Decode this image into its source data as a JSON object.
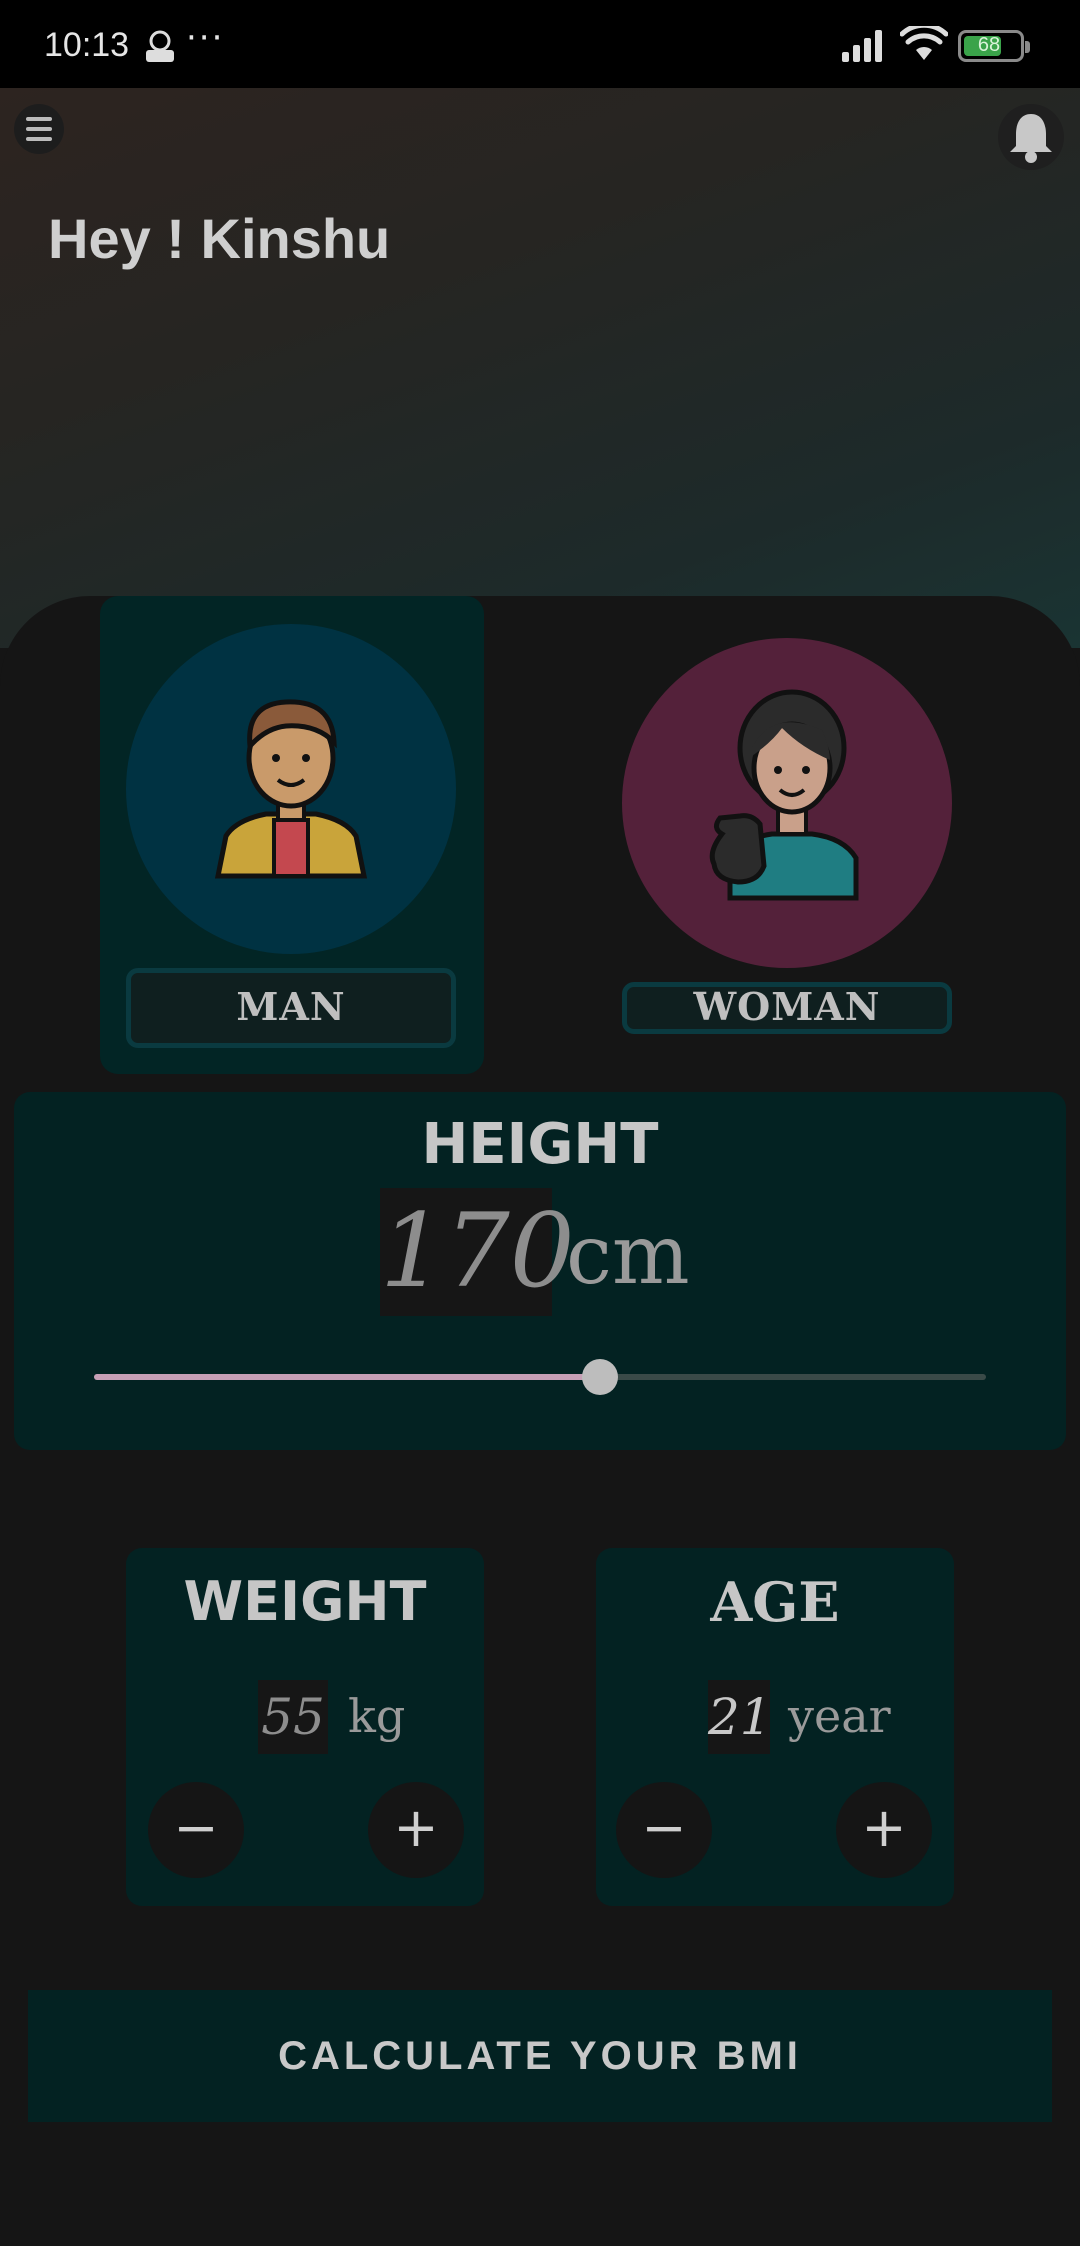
{
  "status_bar": {
    "time": "10:13",
    "dots": "···",
    "battery_level": 68,
    "battery_text": "68"
  },
  "header": {
    "greeting": "Hey ! Kinshu",
    "menu_icon": "hamburger-icon",
    "bell_icon": "bell-icon"
  },
  "gender": {
    "selected": "man",
    "man_label": "MAN",
    "woman_label": "WOMAN",
    "man_color": "#003242",
    "woman_color": "#54213a",
    "selected_card_color": "#022525"
  },
  "height": {
    "title": "HEIGHT",
    "value": "170",
    "unit": "cm",
    "slider_fraction": 0.567
  },
  "weight": {
    "title": "WEIGHT",
    "value": "55",
    "unit": "kg",
    "minus": "−",
    "plus": "+"
  },
  "age": {
    "title": "AGE",
    "value": "21",
    "unit": "year",
    "minus": "−",
    "plus": "+"
  },
  "calculate_label": "CALCULATE YOUR BMI",
  "colors": {
    "card": "#032222",
    "slider_active": "#c6a0b6",
    "background": "#151515"
  }
}
